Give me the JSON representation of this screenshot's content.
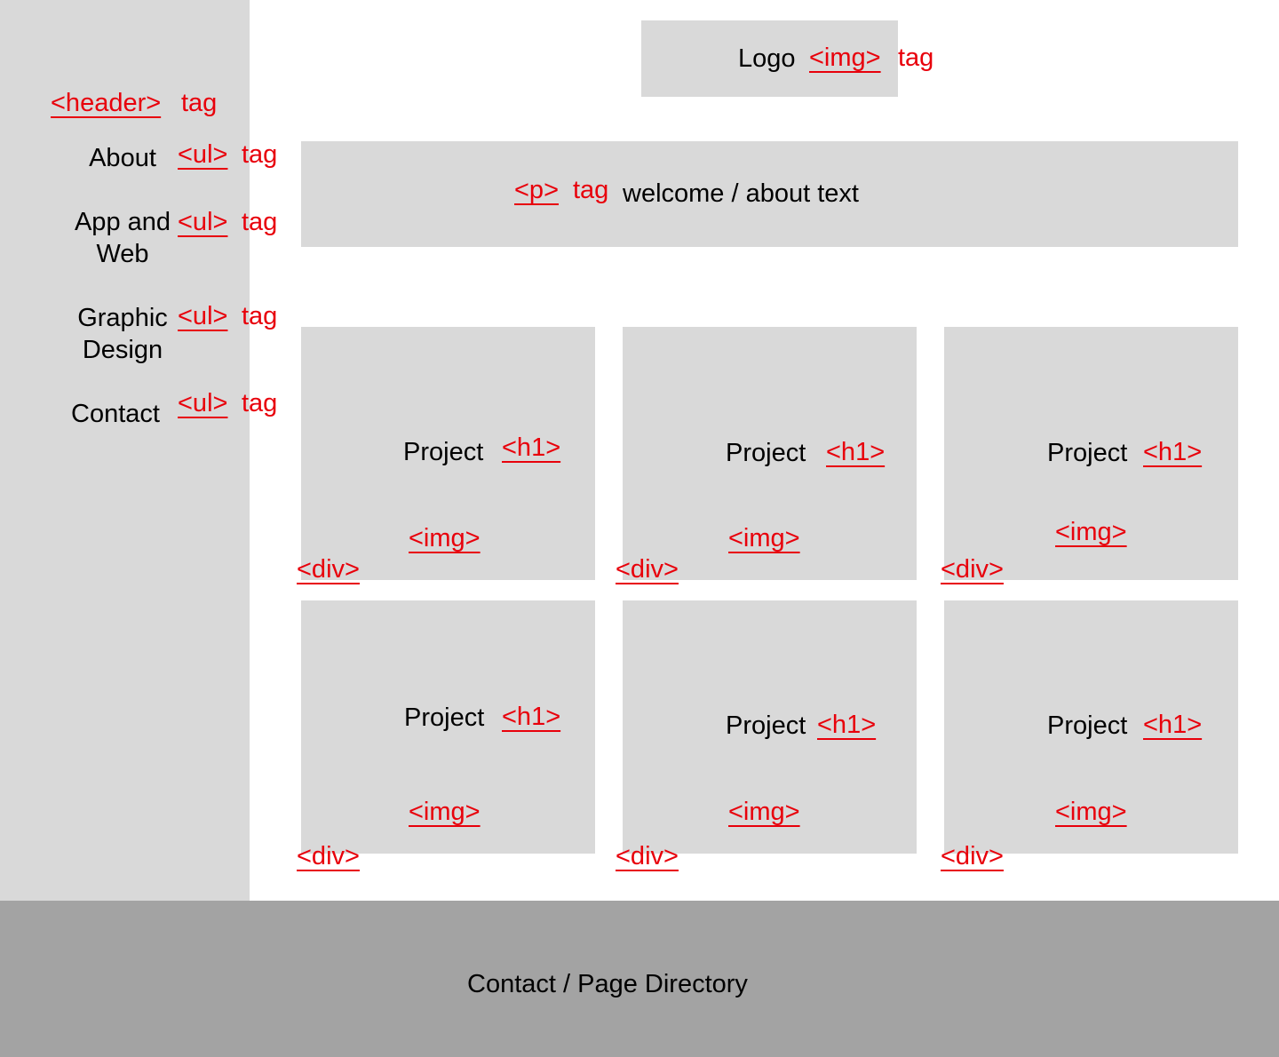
{
  "sidebar": {
    "header_tag": "<header>",
    "header_suffix": "tag",
    "nav_items": [
      {
        "label_lines": [
          "About"
        ],
        "tag": "<ul>",
        "suffix": "tag"
      },
      {
        "label_lines": [
          "App and",
          "Web"
        ],
        "tag": "<ul>",
        "suffix": "tag"
      },
      {
        "label_lines": [
          "Graphic",
          "Design"
        ],
        "tag": "<ul>",
        "suffix": "tag"
      },
      {
        "label_lines": [
          "Contact"
        ],
        "tag": "<ul>",
        "suffix": "tag"
      }
    ]
  },
  "logo": {
    "label": "Logo",
    "tag": "<img>",
    "suffix": "tag"
  },
  "welcome": {
    "tag": "<p>",
    "suffix": "tag",
    "text": "welcome / about text"
  },
  "projects": [
    {
      "title": "Project",
      "heading_tag": "<h1>",
      "image_tag": "<img>",
      "container_tag": "<div>"
    },
    {
      "title": "Project",
      "heading_tag": "<h1>",
      "image_tag": "<img>",
      "container_tag": "<div>"
    },
    {
      "title": "Project",
      "heading_tag": "<h1>",
      "image_tag": "<img>",
      "container_tag": "<div>"
    },
    {
      "title": "Project",
      "heading_tag": "<h1>",
      "image_tag": "<img>",
      "container_tag": "<div>"
    },
    {
      "title": "Project",
      "heading_tag": "<h1>",
      "image_tag": "<img>",
      "container_tag": "<div>"
    },
    {
      "title": "Project",
      "heading_tag": "<h1>",
      "image_tag": "<img>",
      "container_tag": "<div>"
    }
  ],
  "footer": {
    "text": "Contact / Page Directory"
  },
  "colors": {
    "annotation_red": "#e8000b",
    "block_gray": "#d9d9d9",
    "footer_gray": "#a3a3a3",
    "background": "#ffffff"
  }
}
